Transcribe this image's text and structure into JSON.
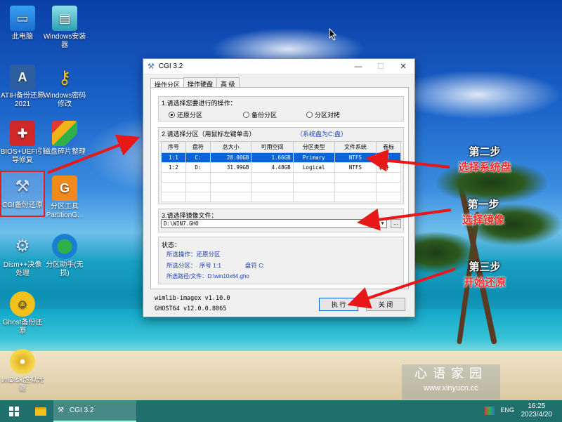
{
  "desktop": {
    "icons": [
      {
        "label": "此电脑",
        "icon": "computer-icon"
      },
      {
        "label": "Windows安装器",
        "icon": "installer-icon"
      },
      {
        "label": "ATIH备份还原2021",
        "icon": "atih-icon"
      },
      {
        "label": "Windows密码修改",
        "icon": "key-icon"
      },
      {
        "label": "BIOS+UEFI引导修复",
        "icon": "repair-icon"
      },
      {
        "label": "磁盘碎片整理",
        "icon": "defrag-icon"
      },
      {
        "label": "CGI备份还原",
        "icon": "cgi-icon"
      },
      {
        "label": "分区工具PartitionG...",
        "icon": "partition-icon"
      },
      {
        "label": "Dism++决像处理",
        "icon": "dism-icon"
      },
      {
        "label": "分区助手(无损)",
        "icon": "partition-assistant-icon"
      },
      {
        "label": "Ghost备份还原",
        "icon": "ghost-icon"
      },
      {
        "label": "ImDisk虚拟光驱",
        "icon": "disk-icon"
      }
    ]
  },
  "window": {
    "title": "CGI 3.2",
    "tabs": [
      "操作分区",
      "操作硬盘",
      "高 级"
    ],
    "section1": {
      "label": "1.请选择您要进行的操作：",
      "options": [
        "还原分区",
        "备份分区",
        "分区对拷"
      ],
      "selected": "还原分区"
    },
    "section2": {
      "label": "2.请选择分区（用鼠标左键单击）",
      "hint": "（系统盘为C:盘）",
      "columns": [
        "序号",
        "盘符",
        "总大小",
        "可用空间",
        "分区类型",
        "文件系统",
        "卷标"
      ],
      "rows": [
        [
          "1:1",
          "C:",
          "28.00GB",
          "1.66GB",
          "Primary",
          "NTFS",
          "系统"
        ],
        [
          "1:2",
          "D:",
          "31.99GB",
          "4.48GB",
          "Logical",
          "NTFS",
          "软件"
        ]
      ]
    },
    "section3": {
      "label": "3.请选择镜像文件：",
      "value": "D:\\WIN7.GHO",
      "browse": "..."
    },
    "status": {
      "label": "状态：",
      "lines": [
        "所选操作：还原分区",
        "所选分区：　序号 1:1　　　　盘符 C:",
        "所选路径/文件：D:\\win10x64.gho"
      ]
    },
    "footer": {
      "line1": "wimlib-imagex v1.10.0",
      "line2": "GHOST64 v12.0.0.8065"
    },
    "buttons": {
      "execute": "执 行",
      "close": "关 闭"
    }
  },
  "annotations": [
    {
      "step": "第二步",
      "text": "选择系统盘"
    },
    {
      "step": "第一步",
      "text": "选择镜像"
    },
    {
      "step": "第三步",
      "text": "开始还原"
    }
  ],
  "watermark": {
    "line1": "心语家园",
    "line2": "www.xinyucn.cc"
  },
  "taskbar": {
    "app_label": "CGI 3.2",
    "lang": "ENG",
    "time": "16:25",
    "date": "2023/4/20"
  },
  "colors": {
    "accent": "#0a64d8",
    "annotation": "#ff2a2a",
    "taskbar": "#1f6f6c"
  }
}
